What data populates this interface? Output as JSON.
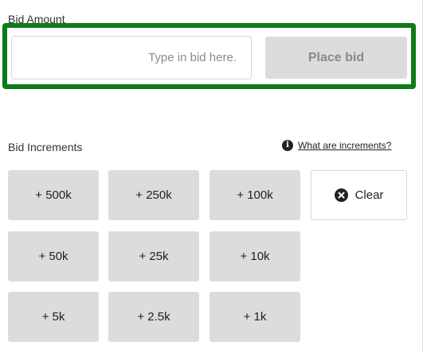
{
  "bid_form": {
    "label": "Bid Amount",
    "input_placeholder": "Type in bid here.",
    "input_value": "",
    "place_bid_label": "Place bid",
    "highlight_color": "#0f7a18"
  },
  "increments": {
    "label": "Bid Increments",
    "help_icon": "info-icon",
    "help_link": "What are increments?",
    "buttons": [
      "+ 500k",
      "+ 250k",
      "+ 100k",
      "+ 50k",
      "+ 25k",
      "+ 10k",
      "+ 5k",
      "+ 2.5k",
      "+ 1k"
    ],
    "clear_icon": "close-circle-icon",
    "clear_label": "Clear"
  }
}
